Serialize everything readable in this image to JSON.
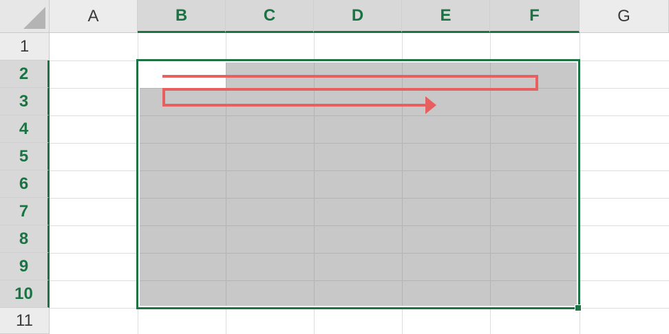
{
  "columns": [
    {
      "label": "A",
      "selected": false
    },
    {
      "label": "B",
      "selected": true
    },
    {
      "label": "C",
      "selected": true
    },
    {
      "label": "D",
      "selected": true
    },
    {
      "label": "E",
      "selected": true
    },
    {
      "label": "F",
      "selected": true
    },
    {
      "label": "G",
      "selected": false
    }
  ],
  "rows": [
    {
      "label": "1",
      "selected": false
    },
    {
      "label": "2",
      "selected": true
    },
    {
      "label": "3",
      "selected": true
    },
    {
      "label": "4",
      "selected": true
    },
    {
      "label": "5",
      "selected": true
    },
    {
      "label": "6",
      "selected": true
    },
    {
      "label": "7",
      "selected": true
    },
    {
      "label": "8",
      "selected": true
    },
    {
      "label": "9",
      "selected": true
    },
    {
      "label": "10",
      "selected": true
    },
    {
      "label": "11",
      "selected": false
    }
  ],
  "selection": {
    "start_cell": "B2",
    "end_cell": "F10",
    "active_cell": "B2"
  },
  "colors": {
    "selection_border": "#1f7244",
    "selected_header_text": "#1a7342",
    "selection_fill": "#c8c8c8",
    "arrow": "#e85f5f"
  },
  "annotation_icon": "traversal-arrow-icon"
}
